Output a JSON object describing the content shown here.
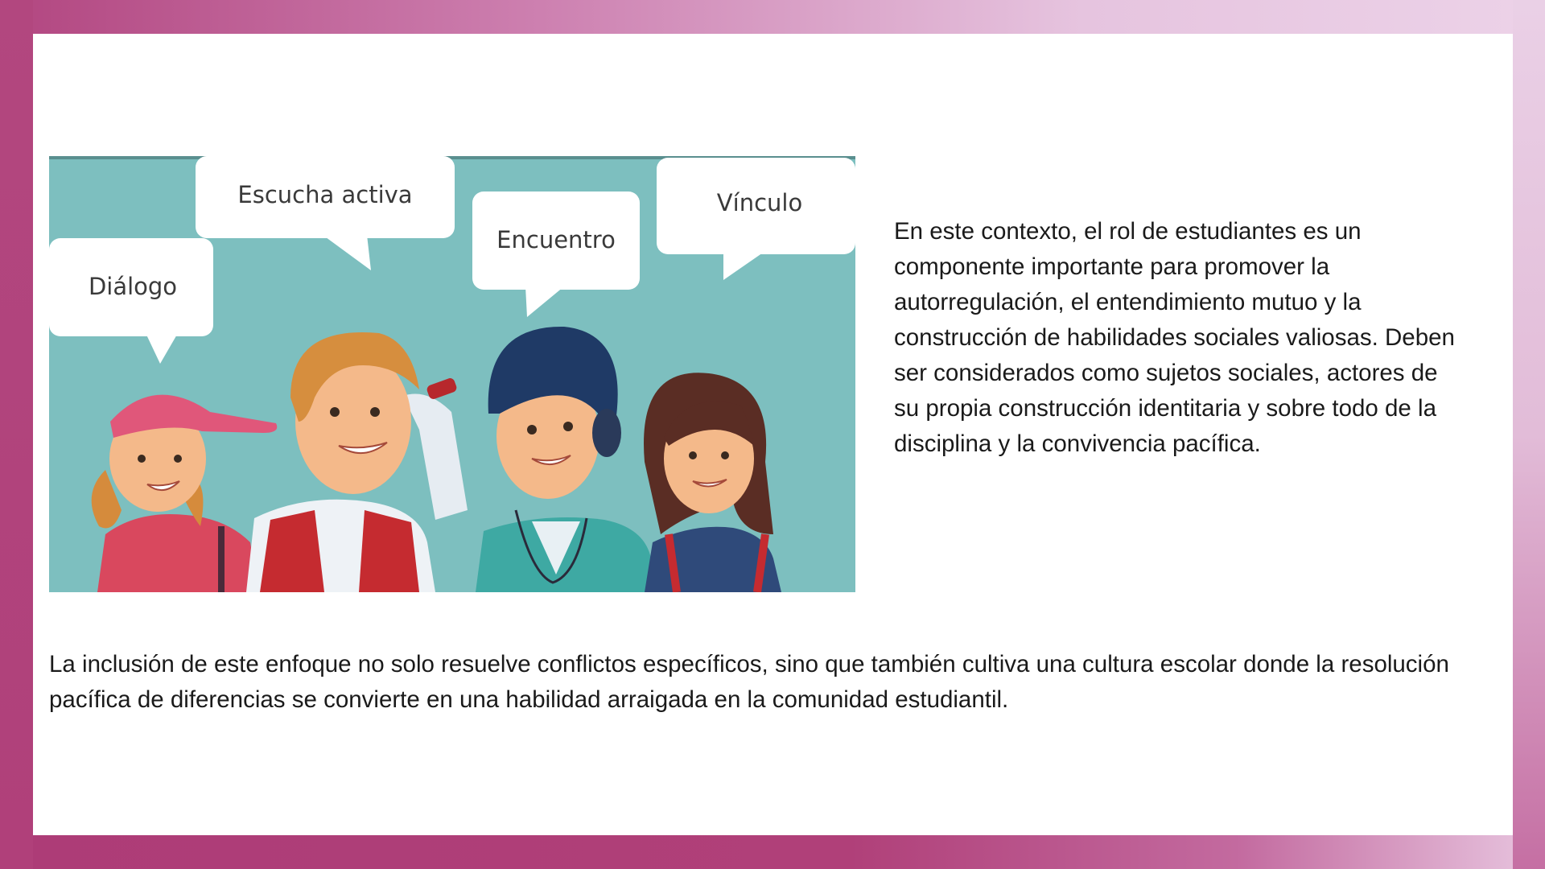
{
  "illustration": {
    "bubbles": {
      "dialogo": "Diálogo",
      "escucha": "Escucha activa",
      "encuentro": "Encuentro",
      "vinculo": "Vínculo"
    },
    "colors": {
      "background": "#7dbfbf",
      "bubble": "#ffffff"
    }
  },
  "content": {
    "side_paragraph": "En este contexto, el rol de estudiantes es un componente importante para promover la autorregulación, el entendimiento mutuo y la construcción de habilidades sociales valiosas. Deben ser considerados como sujetos sociales, actores de su propia construcción identitaria y sobre todo de la disciplina y la convivencia pacífica.",
    "bottom_paragraph": "La inclusión de este enfoque no solo resuelve conflictos específicos, sino que también cultiva una cultura escolar donde la resolución pacífica de diferencias se convierte en una habilidad arraigada en la comunidad estudiantil."
  }
}
